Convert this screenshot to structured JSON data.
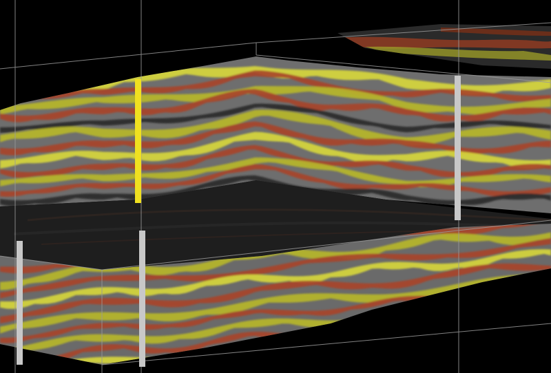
{
  "scene": {
    "background": "#000000",
    "palette": {
      "yellow": "#b8b82a",
      "yellow_bright": "#d8d83a",
      "red": "#a8442a",
      "gray": "#7a7a7a",
      "dark": "#2a2a2a",
      "bbox_line": "#9a9a9a",
      "well_gray": "#c8c8c8",
      "well_orange": "#e8902a",
      "well_yellow": "#f0e020"
    },
    "panels": [
      "upper-seismic-section",
      "horizon-slice",
      "lower-seismic-section",
      "far-time-slice"
    ],
    "wells": [
      {
        "id": "well-a"
      },
      {
        "id": "well-b"
      },
      {
        "id": "well-c"
      },
      {
        "id": "well-d"
      }
    ]
  }
}
